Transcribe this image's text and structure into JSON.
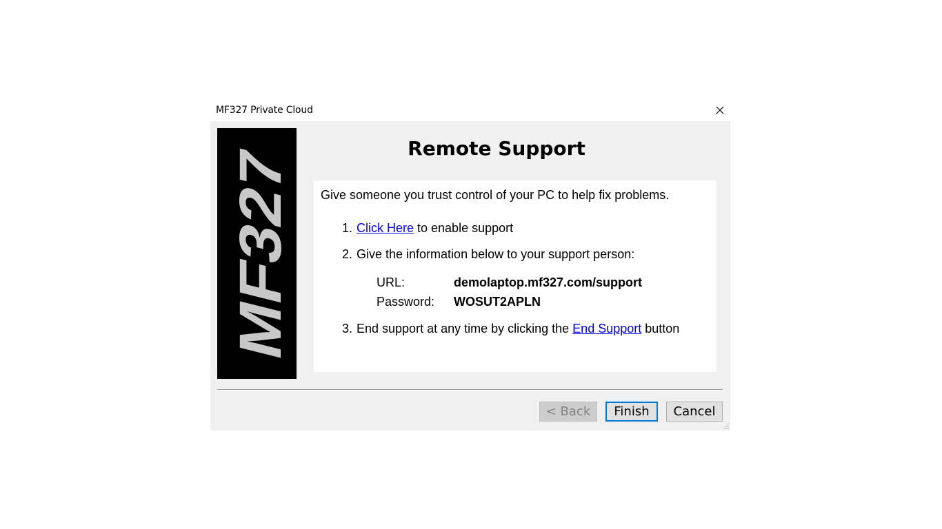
{
  "window": {
    "title": "MF327 Private Cloud"
  },
  "logo": {
    "text": "MF327"
  },
  "heading": "Remote Support",
  "intro": "Give someone you trust control of your PC to help fix problems.",
  "steps": [
    {
      "number": "1.",
      "link": "Click Here",
      "after": " to enable support"
    },
    {
      "number": "2.",
      "text": "Give the information below to your support person:"
    },
    {
      "number": "3.",
      "before": "End support at any time by clicking the ",
      "link": "End Support",
      "after": " button"
    }
  ],
  "info": {
    "url_label": "URL:",
    "url_value": "demolaptop.mf327.com/support",
    "password_label": "Password:",
    "password_value": "WOSUT2APLN"
  },
  "buttons": {
    "back": "< Back",
    "finish": "Finish",
    "cancel": "Cancel"
  },
  "colors": {
    "link": "#0000ee",
    "focus_border": "#0078d7",
    "logo_background": "#000000",
    "logo_text": "#c8c8c8"
  }
}
